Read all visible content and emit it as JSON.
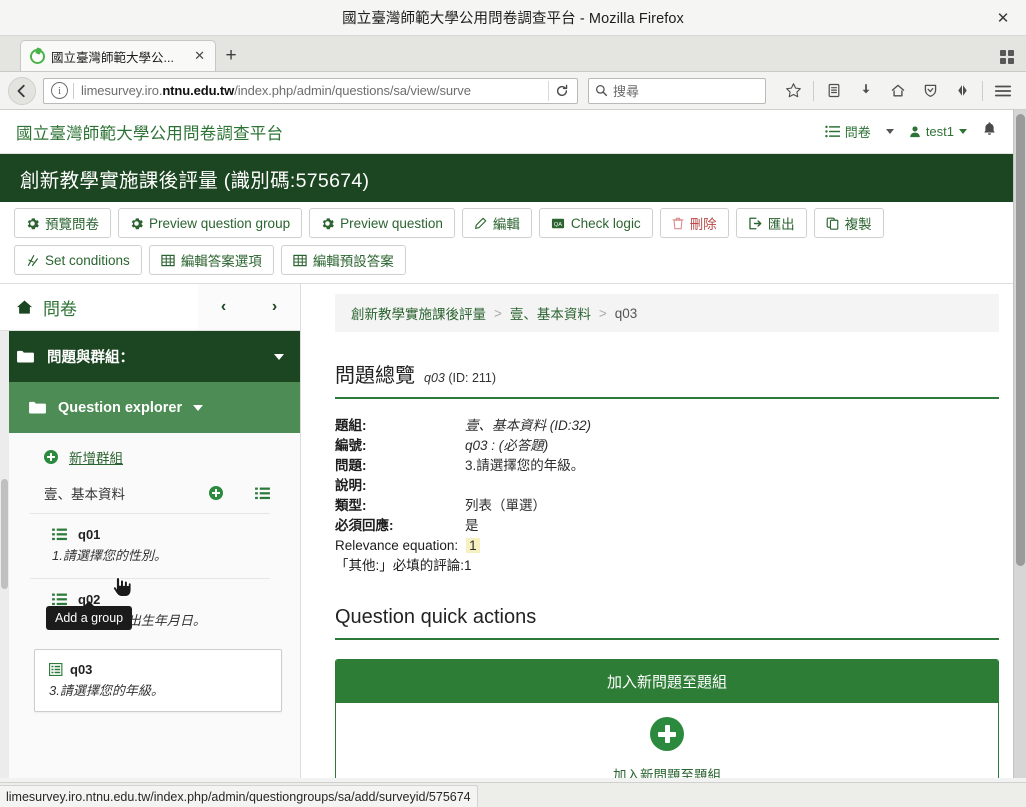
{
  "browser": {
    "window_title": "國立臺灣師範大學公用問卷調查平台 - Mozilla Firefox",
    "close_label": "✕",
    "tab": {
      "title": "國立臺灣師範大學公...",
      "close_label": "✕",
      "newtab_label": "+"
    },
    "url_prefix": "limesurvey.iro.",
    "url_domain": "ntnu.edu.tw",
    "url_suffix": "/index.php/admin/questions/sa/view/surve",
    "search_placeholder": "搜尋",
    "status_url": "limesurvey.iro.ntnu.edu.tw/index.php/admin/questiongroups/sa/add/surveyid/575674"
  },
  "app": {
    "brand": "國立臺灣師範大學公用問卷調查平台",
    "top_nav": {
      "surveys_label": "問卷",
      "user_label": "test1"
    },
    "survey_title": "創新教學實施課後評量 (識別碼:575674)"
  },
  "toolbar": {
    "row1": [
      {
        "label": "預覽問卷",
        "icon": "gear-icon",
        "style": "normal"
      },
      {
        "label": "Preview question group",
        "icon": "gear-icon",
        "style": "normal"
      },
      {
        "label": "Preview question",
        "icon": "gear-icon",
        "style": "normal"
      },
      {
        "label": "編輯",
        "icon": "pencil-icon",
        "style": "normal"
      },
      {
        "label": "Check logic",
        "icon": "logic-icon",
        "style": "normal"
      },
      {
        "label": "刪除",
        "icon": "trash-icon",
        "style": "danger"
      },
      {
        "label": "匯出",
        "icon": "export-icon",
        "style": "normal"
      },
      {
        "label": "複製",
        "icon": "copy-icon",
        "style": "normal"
      }
    ],
    "row2": [
      {
        "label": "Set conditions",
        "icon": "conditions-icon",
        "style": "normal"
      },
      {
        "label": "編輯答案選項",
        "icon": "table-icon",
        "style": "normal"
      },
      {
        "label": "編輯預設答案",
        "icon": "table-icon",
        "style": "normal"
      }
    ]
  },
  "sidebar": {
    "header_title": "問卷",
    "prev_label": "‹",
    "next_label": "›",
    "group_header_label": "問題與群組：",
    "explorer_label": "Question explorer",
    "add_group_label": "新增群組",
    "group_name": "壹、基本資料",
    "tooltip_text": "Add a group",
    "questions": [
      {
        "code": "q01",
        "text": "1.請選擇您的性別。",
        "icon": "list-icon",
        "selected": false
      },
      {
        "code": "q02",
        "text": "2.請選擇您的出生年月日。",
        "icon": "list-icon",
        "selected": false
      },
      {
        "code": "q03",
        "text": "3.請選擇您的年級。",
        "icon": "list-alt-icon",
        "selected": true
      }
    ]
  },
  "main": {
    "breadcrumb": {
      "survey": "創新教學實施課後評量",
      "group": "壹、基本資料",
      "question": "q03",
      "separator": ">"
    },
    "overview": {
      "heading": "問題總覽",
      "code": "q03",
      "id_text": "(ID: 211)",
      "rows": [
        {
          "label": "題組:",
          "value": "壹、基本資料 (ID:32)",
          "italic_value": true
        },
        {
          "label": "編號:",
          "value": "q03 : (必答題)",
          "italic_value": true
        },
        {
          "label": "問題:",
          "value": "3.請選擇您的年級。",
          "italic_value": false
        },
        {
          "label": "說明:",
          "value": "",
          "italic_value": false
        },
        {
          "label": "類型:",
          "value": "列表（單選）",
          "italic_value": false
        },
        {
          "label": "必須回應:",
          "value": "是",
          "italic_value": false
        }
      ],
      "relevance_label": "Relevance equation:",
      "relevance_value": "1",
      "other_comment_text": "「其他:」必填的評論:1"
    },
    "quick_actions": {
      "heading": "Question quick actions",
      "panel_header": "加入新問題至題組",
      "panel_label": "加入新問題至題組"
    }
  },
  "colors": {
    "dark_green": "#1c4621",
    "mid_green": "#4e8c55",
    "accent_green": "#2b7a39",
    "link_green": "#2b6430",
    "danger_red": "#b94a48",
    "highlight_yellow": "#f7f0c0"
  }
}
